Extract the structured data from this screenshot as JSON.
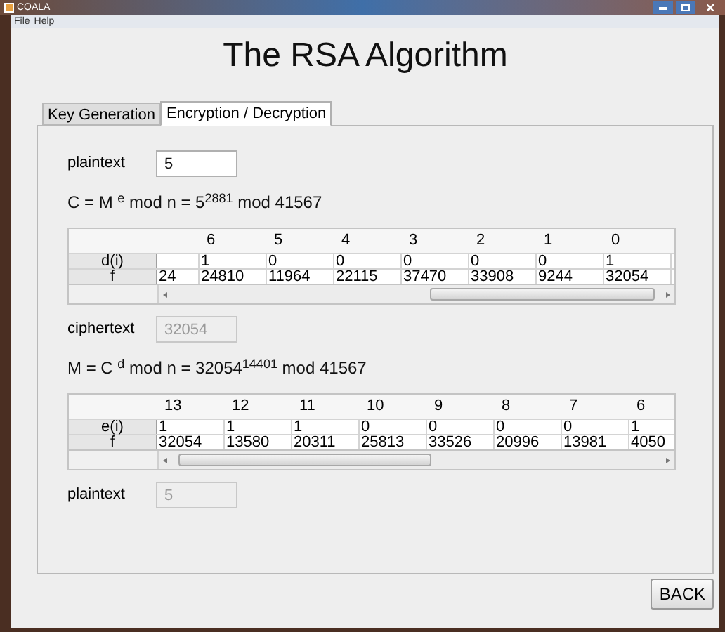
{
  "window": {
    "title": "COALA"
  },
  "menu": [
    "File",
    "Help"
  ],
  "heading": "The RSA Algorithm",
  "tabs": [
    {
      "label": "Key Generation",
      "selected": false
    },
    {
      "label": "Encryption / Decryption",
      "selected": true
    }
  ],
  "sections": [
    {
      "kind": "field",
      "label": "plaintext",
      "value": "5",
      "disabled": false
    },
    {
      "kind": "formula",
      "text": "C = M $^{e}$ mod n = 5$^{2881}$ mod 41567"
    },
    {
      "kind": "table",
      "row_labels": [
        "d(i)",
        "f"
      ],
      "columns": [
        {
          "f": "24"
        },
        {
          "header": "6",
          "bit": "1",
          "f": "24810"
        },
        {
          "header": "5",
          "bit": "0",
          "f": "11964"
        },
        {
          "header": "4",
          "bit": "0",
          "f": "22115"
        },
        {
          "header": "3",
          "bit": "0",
          "f": "37470"
        },
        {
          "header": "2",
          "bit": "0",
          "f": "33908"
        },
        {
          "header": "1",
          "bit": "0",
          "f": "9244"
        },
        {
          "header": "0",
          "bit": "1",
          "f": "32054"
        }
      ]
    },
    {
      "kind": "field",
      "label": "ciphertext",
      "value": "32054",
      "disabled": true
    },
    {
      "kind": "formula",
      "text": "M = C $^{d}$ mod n = 32054$^{14401}$ mod 41567"
    },
    {
      "kind": "table",
      "row_labels": [
        "e(i)",
        "f"
      ],
      "columns": [
        {
          "header": "13",
          "bit": "1",
          "f": "32054"
        },
        {
          "header": "12",
          "bit": "1",
          "f": "13580"
        },
        {
          "header": "11",
          "bit": "1",
          "f": "20311"
        },
        {
          "header": "10",
          "bit": "0",
          "f": "25813"
        },
        {
          "header": "9",
          "bit": "0",
          "f": "33526"
        },
        {
          "header": "8",
          "bit": "0",
          "f": "20996"
        },
        {
          "header": "7",
          "bit": "0",
          "f": "13981"
        },
        {
          "header": "6",
          "bit": "1",
          "f": "4050"
        }
      ]
    },
    {
      "kind": "field",
      "label": "plaintext",
      "value": "5",
      "disabled": true
    }
  ],
  "back_button": "BACK"
}
